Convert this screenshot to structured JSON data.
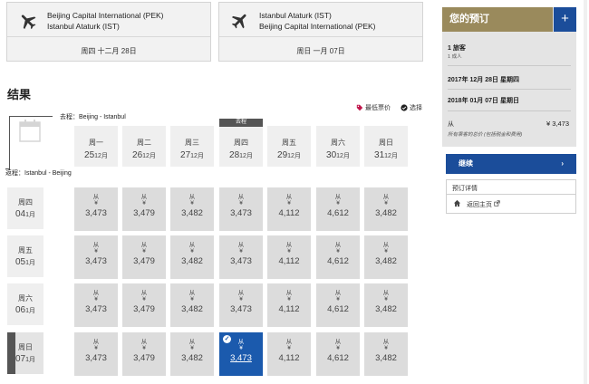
{
  "flights": [
    {
      "line1": "Beijing Capital International (PEK)",
      "line2": "Istanbul Ataturk (IST)",
      "date": "周四 十二月 28日"
    },
    {
      "line1": "Istanbul Ataturk (IST)",
      "line2": "Beijing Capital International (PEK)",
      "date": "周日 一月 07日"
    }
  ],
  "results": {
    "title": "结果",
    "legend_lowest": "最低票价",
    "legend_selected": "选择",
    "outbound_label": "去程：Beijing - Istanbul",
    "return_label": "返程：Istanbul - Beijing",
    "selected_tag": "去程",
    "columns": [
      {
        "weekday": "周一",
        "day": "25",
        "month": "12月"
      },
      {
        "weekday": "周二",
        "day": "26",
        "month": "12月"
      },
      {
        "weekday": "周三",
        "day": "27",
        "month": "12月"
      },
      {
        "weekday": "周四",
        "day": "28",
        "month": "12月"
      },
      {
        "weekday": "周五",
        "day": "29",
        "month": "12月"
      },
      {
        "weekday": "周六",
        "day": "30",
        "month": "12月"
      },
      {
        "weekday": "周日",
        "day": "31",
        "month": "12月"
      }
    ],
    "rows": [
      {
        "weekday": "周四",
        "day": "04",
        "month": "1月",
        "prices": [
          "3,473",
          "3,479",
          "3,482",
          "3,473",
          "4,112",
          "4,612",
          "3,482"
        ]
      },
      {
        "weekday": "周五",
        "day": "05",
        "month": "1月",
        "prices": [
          "3,473",
          "3,479",
          "3,482",
          "3,473",
          "4,112",
          "4,612",
          "3,482"
        ]
      },
      {
        "weekday": "周六",
        "day": "06",
        "month": "1月",
        "prices": [
          "3,473",
          "3,479",
          "3,482",
          "3,473",
          "4,112",
          "4,612",
          "3,482"
        ]
      },
      {
        "weekday": "周日",
        "day": "07",
        "month": "1月",
        "prices": [
          "3,473",
          "3,479",
          "3,482",
          "3,473",
          "4,112",
          "4,612",
          "3,482"
        ]
      }
    ],
    "from_label": "从",
    "currency": "¥",
    "selected_cell": {
      "row": 3,
      "col": 3
    }
  },
  "booking": {
    "title": "您的预订",
    "plus": "+",
    "passengers": "1 旅客",
    "passengers_detail": "1 成人",
    "depart_date": "2017年 12月 28日 星期四",
    "return_date": "2018年 01月 07日 星期日",
    "from_label": "从",
    "total_price": "¥ 3,473",
    "price_note": "所有乘客的总价 (包括税金和费用)",
    "continue_label": "继续",
    "continue_arrow": "›",
    "details_link": "预订详情",
    "home_link": "返回主页"
  },
  "colors": {
    "brand": "#1b4d9a",
    "header_gold": "#9a8a5c",
    "cell": "#dcdcdc",
    "selected": "#1b5aad"
  }
}
